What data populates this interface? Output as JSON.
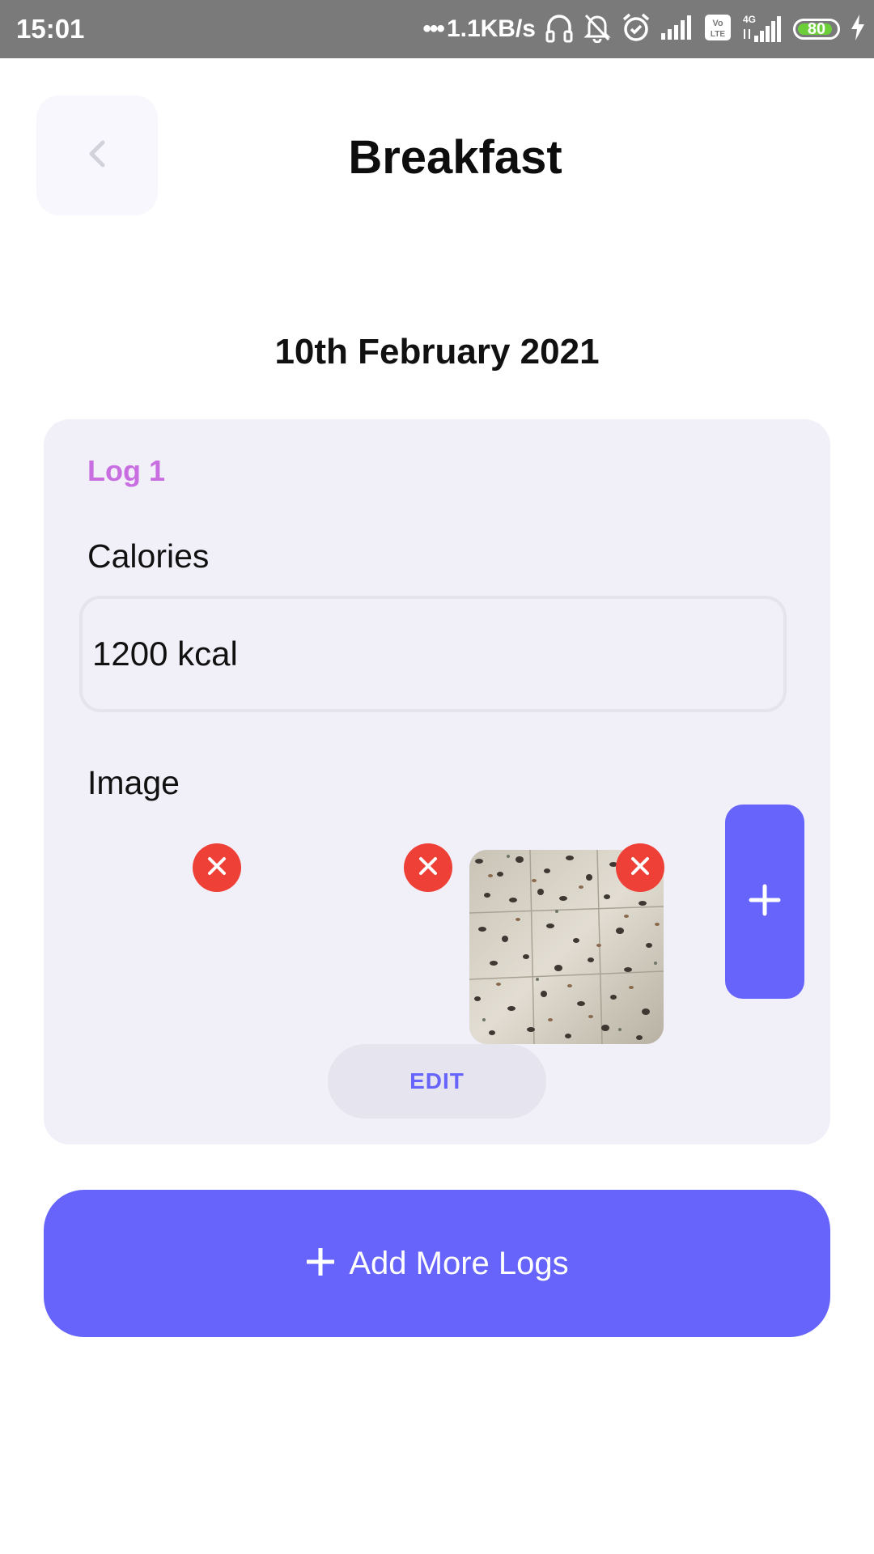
{
  "status_bar": {
    "time": "15:01",
    "net_speed": "1.1KB/s",
    "battery_level": "80",
    "icons": [
      "headphones-icon",
      "mute-bell-icon",
      "alarm-icon",
      "signal-icon",
      "volte-icon",
      "4g-signal-icon",
      "battery-icon",
      "charging-icon"
    ]
  },
  "header": {
    "back_icon": "chevron-left-icon",
    "title": "Breakfast"
  },
  "date": "10th February 2021",
  "log": {
    "title": "Log 1",
    "calories_label": "Calories",
    "calories_value": "1200 kcal",
    "image_label": "Image",
    "images": [
      {
        "has_photo": false
      },
      {
        "has_photo": false
      },
      {
        "has_photo": true,
        "description_icon": "photo-thumbnail"
      }
    ],
    "remove_icon": "close-icon",
    "add_image_icon": "plus-icon",
    "edit_label": "EDIT"
  },
  "add_logs": {
    "icon": "plus-icon",
    "label": "Add More Logs"
  },
  "colors": {
    "accent": "#6764fb",
    "log_title": "#c86ee0",
    "card_bg": "#f1f0f9",
    "remove": "#ee4036",
    "status_bar": "#7a7a7a"
  }
}
